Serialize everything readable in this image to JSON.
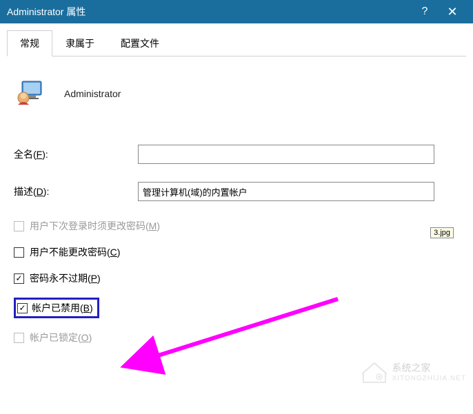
{
  "titlebar": {
    "title": "Administrator 属性",
    "help": "?",
    "close": "✕"
  },
  "tabs": [
    {
      "label": "常规",
      "active": true
    },
    {
      "label": "隶属于",
      "active": false
    },
    {
      "label": "配置文件",
      "active": false
    }
  ],
  "user": {
    "name": "Administrator",
    "icon": "user-monitor-icon"
  },
  "form": {
    "fullname_label": "全名(F):",
    "fullname_value": "",
    "description_label": "描述(D):",
    "description_value": "管理计算机(域)的内置帐户"
  },
  "checks": {
    "must_change": {
      "label": "用户下次登录时须更改密码(M)",
      "checked": false,
      "disabled": true
    },
    "cannot_change": {
      "label": "用户不能更改密码(C)",
      "checked": false,
      "disabled": false
    },
    "never_expire": {
      "label": "密码永不过期(P)",
      "checked": true,
      "disabled": false
    },
    "disabled_acct": {
      "label": "帐户已禁用(B)",
      "checked": true,
      "disabled": false,
      "highlight": true
    },
    "locked": {
      "label": "帐户已锁定(O)",
      "checked": false,
      "disabled": true
    }
  },
  "tooltip": "3.jpg",
  "watermark": {
    "cn": "系统之家",
    "url": "XITONGZHIJIA.NET"
  }
}
